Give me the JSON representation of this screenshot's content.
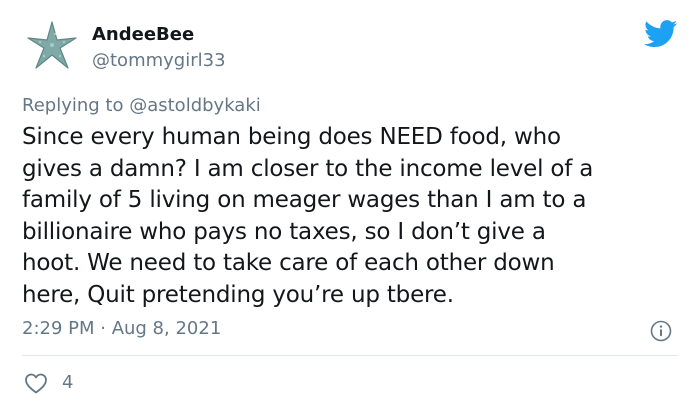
{
  "user": {
    "display_name": "AndeeBee",
    "handle": "@tommygirl33",
    "avatar": "starfish-avatar-icon"
  },
  "reply": {
    "prefix": "Replying to",
    "target": "@astoldbykaki"
  },
  "tweet": {
    "lines": [
      "Since every human being does NEED food, who",
      "gives a damn? I am closer to the income level of a",
      "family of 5 living on meager wages than I am to a",
      "billionaire who pays no taxes, so I don’t give a",
      "hoot. We need to take care of each other down",
      "here, Quit pretending you’re up tbere."
    ],
    "timestamp": "2:29 PM · Aug 8, 2021"
  },
  "stats": {
    "likes": "4"
  },
  "icons": {
    "brand": "twitter-bird-icon",
    "info": "info-icon",
    "like": "heart-icon"
  },
  "colors": {
    "twitter_blue": "#1da1f2",
    "text_primary": "#14171a",
    "text_secondary": "#657786",
    "divider": "#e1e8ed"
  }
}
